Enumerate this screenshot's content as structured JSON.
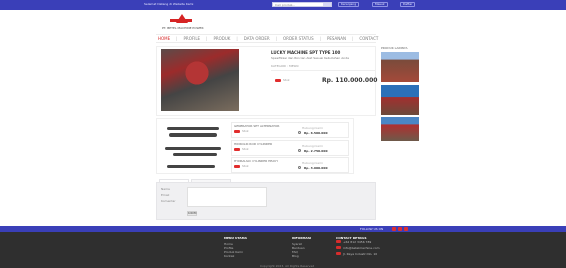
{
  "topbar": {
    "brand_small": "Selamat Datang di Website Kami",
    "search_placeholder": "Cari produk...",
    "pills": [
      "Keranjang",
      "Masuk",
      "Daftar"
    ]
  },
  "header": {
    "logo_text": "PT. BETEL MACHINE POWER",
    "menu": [
      "HOME",
      "PROFILE",
      "PRODUK",
      "DATA ORDER",
      "ORDER STATUS",
      "PESANAN",
      "CONTACT"
    ]
  },
  "product": {
    "title": "LUCKY MACHINE SPT TYPE 100",
    "desc": "Spesifikasi dan Rincian Alat Sesuai Kebutuhan Anda",
    "meta": "KATEGORI : MESIN",
    "badge_label": "Stok",
    "price": "Rp. 110.000.000"
  },
  "gallery": {
    "title": "PRODUK LAINNYA"
  },
  "related": {
    "items": [
      {
        "title": "GENERATOR SET ALTERNATOR",
        "badge": "Stok",
        "kind": "Hubungi kami",
        "price": "Rp. 6.500.000"
      },
      {
        "title": "HIDROLIK ROD CYLINDER",
        "badge": "Stok",
        "kind": "Hubungi kami",
        "price": "Rp. 2.750.000"
      },
      {
        "title": "HYDRAULIC CYLINDER HEAVY",
        "badge": "Stok",
        "kind": "Hubungi kami",
        "price": "Rp. 3.900.000"
      }
    ]
  },
  "comment": {
    "labels": [
      "Nama",
      "Email",
      "Komentar"
    ],
    "submit": "KIRIM"
  },
  "footer": {
    "follow_label": "FOLLOW US ON",
    "col1": {
      "heading": "MENU UTAMA",
      "links": [
        "Home",
        "Profile",
        "Produk Kami",
        "Kontak"
      ]
    },
    "col2": {
      "heading": "INFORMASI",
      "links": [
        "Syarat",
        "Bantuan",
        "FAQ",
        "Blog"
      ]
    },
    "contact": {
      "heading": "CONTACT DETAILS",
      "rows": [
        "+62 812 3456 789",
        "info@betelmachine.com",
        "Jl. Raya Industri No. 10"
      ]
    },
    "copyright": "Copyright 2023. All Rights Reserved"
  },
  "colors": {
    "primary": "#3a3fb8",
    "accent": "#d62424"
  }
}
